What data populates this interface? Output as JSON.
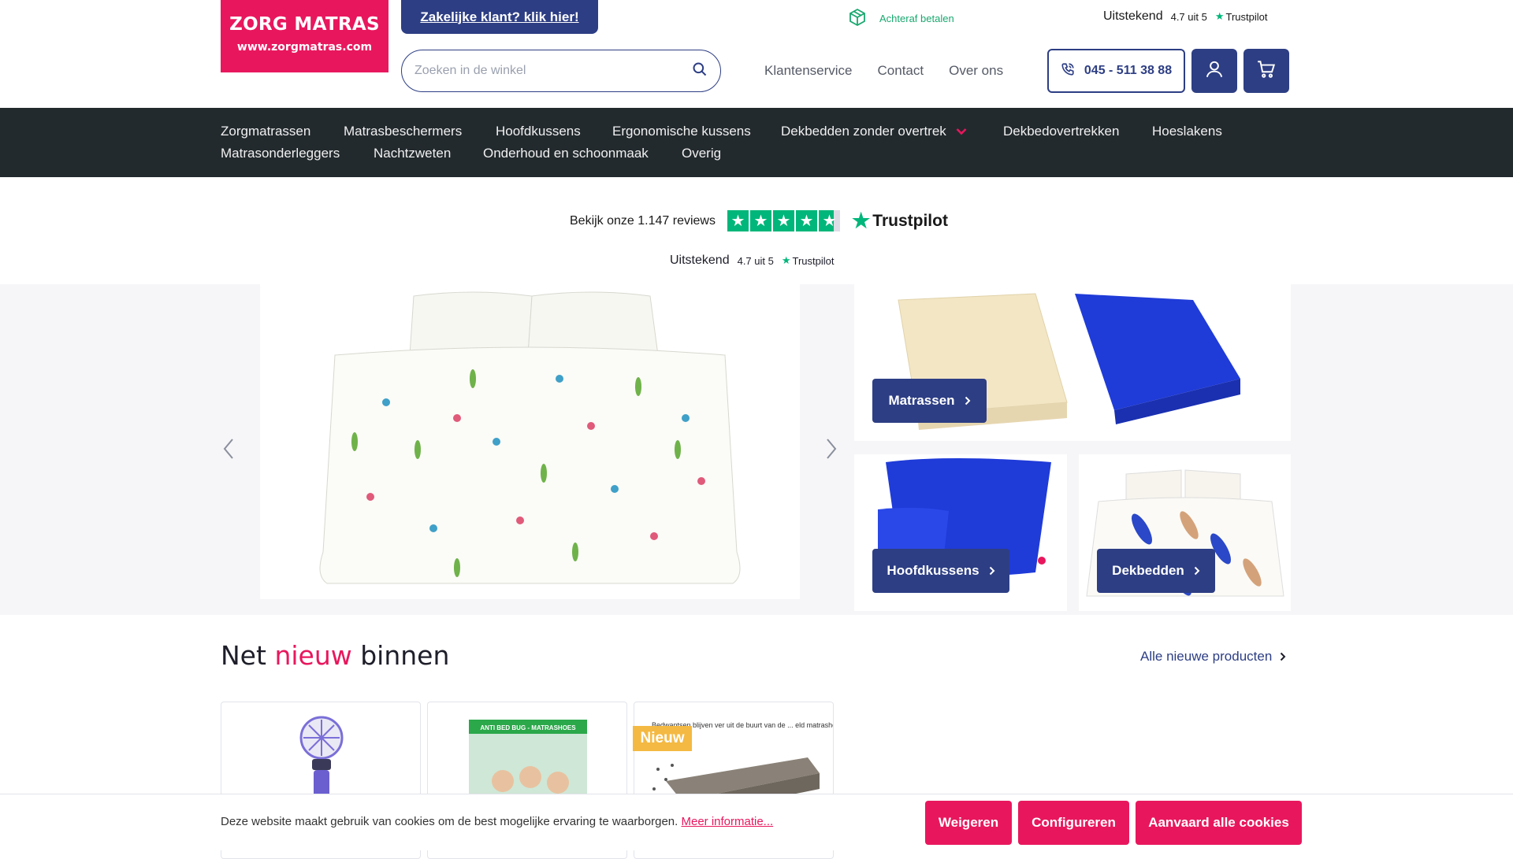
{
  "brand": {
    "name": "ZORG MATRAS",
    "url": "www.zorgmatras.com",
    "accent": "#e8175d",
    "primary": "#2d3e84"
  },
  "header": {
    "business_link": "Zakelijke klant? klik hier!",
    "pay_later": "Achteraf betalen",
    "trustpilot_small": {
      "word": "Uitstekend",
      "score": "4.7 uit 5",
      "brand": "Trustpilot"
    },
    "search_placeholder": "Zoeken in de winkel",
    "links": [
      "Klantenservice",
      "Contact",
      "Over ons"
    ],
    "phone": "045 - 511 38 88"
  },
  "nav": {
    "items": [
      "Zorgmatrassen",
      "Matrasbeschermers",
      "Hoofdkussens",
      "Ergonomische kussens",
      "Dekbedden zonder overtrek",
      "Dekbedovertrekken",
      "Hoeslakens",
      "Matrasonderleggers",
      "Nachtzweten",
      "Onderhoud en schoonmaak",
      "Overig"
    ]
  },
  "trustpilot": {
    "reviews": "Bekijk onze 1.147 reviews",
    "brand": "Trustpilot",
    "word": "Uitstekend",
    "score": "4.7 uit 5"
  },
  "categories": {
    "matrassen": "Matrassen",
    "hoofdkussens": "Hoofdkussens",
    "dekbedden": "Dekbedden"
  },
  "new_in": {
    "title_pre": "Net",
    "title_accent": "nieuw",
    "title_post": "binnen",
    "all_link": "Alle nieuwe producten",
    "badge": "Nieuw",
    "card2_banner": "ANTI BED BUG - MATRASHOES",
    "card3_caption": "Bedwantsen blijven ver uit de buurt van de ... eld matrashoes"
  },
  "cookie": {
    "text": "Deze website maakt gebruik van cookies om de best mogelijke ervaring te waarborgen.",
    "more": "Meer informatie...",
    "refuse": "Weigeren",
    "configure": "Configureren",
    "accept": "Aanvaard alle cookies"
  }
}
